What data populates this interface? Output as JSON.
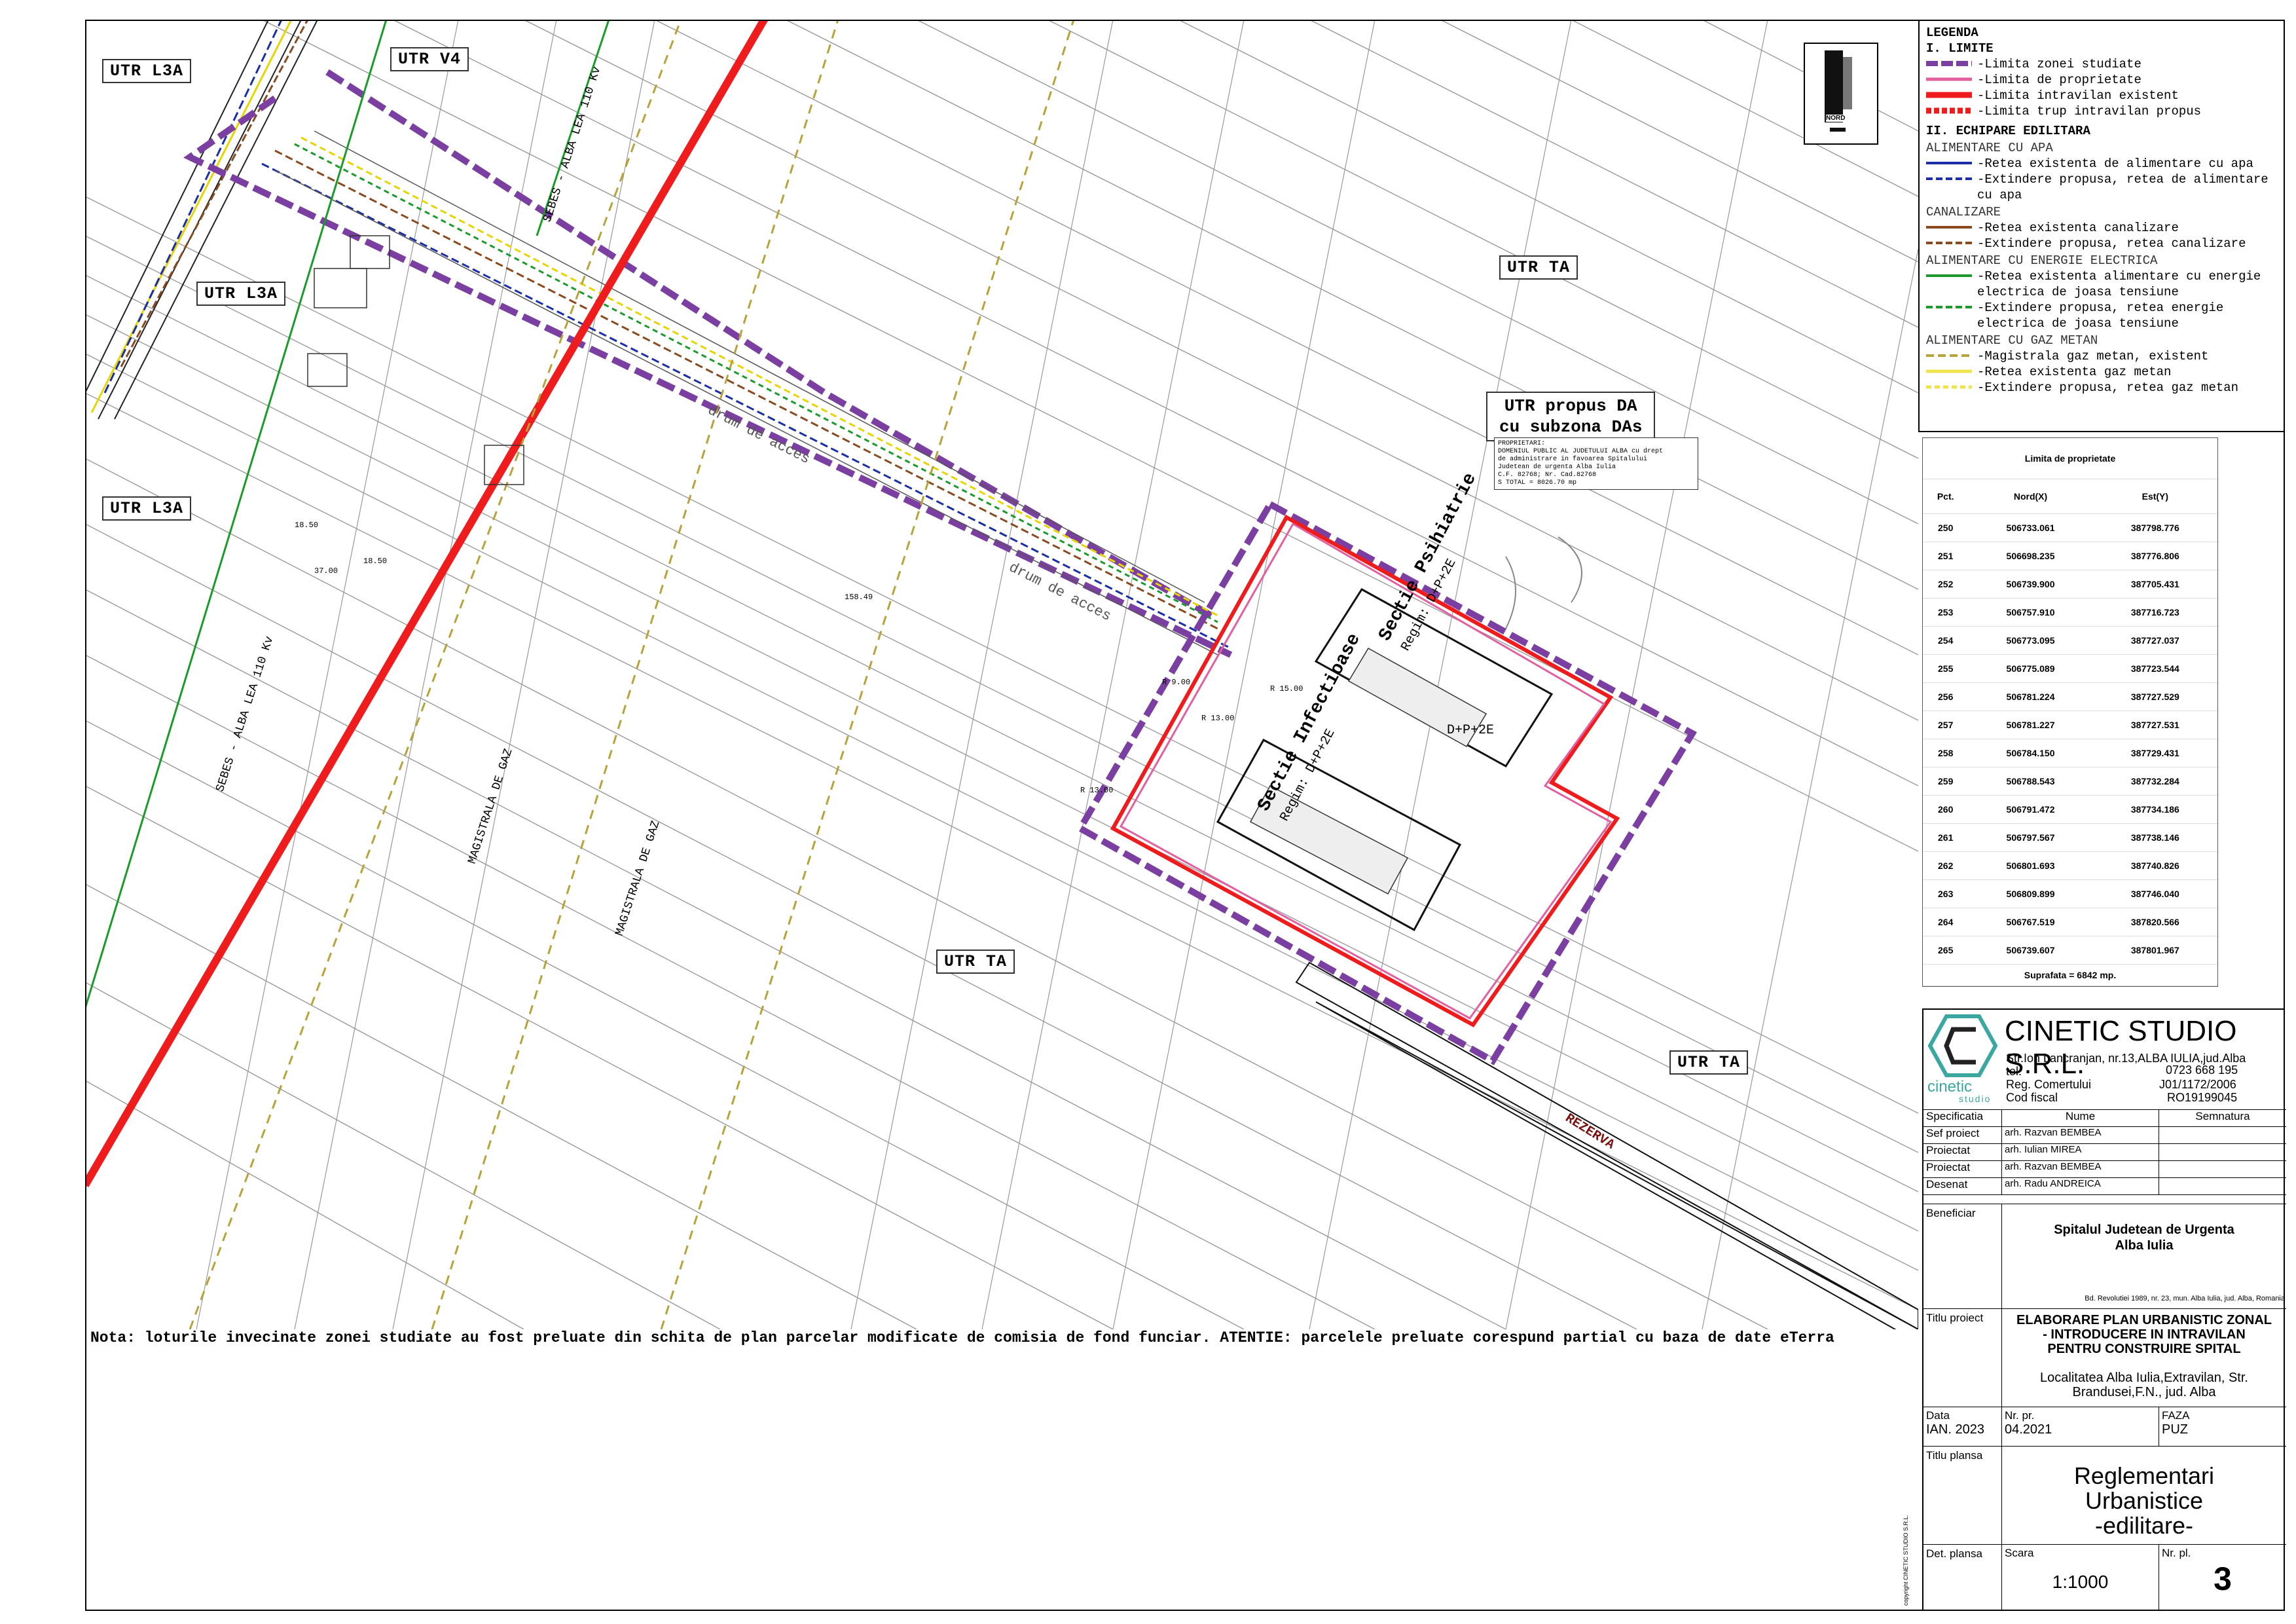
{
  "utr_labels": {
    "l3a_1": "UTR L3A",
    "v4": "UTR V4",
    "l3a_2": "UTR L3A",
    "l3a_3": "UTR L3A",
    "ta_1": "UTR TA",
    "ta_2": "UTR TA",
    "ta_3": "UTR TA",
    "proposed_line1": "UTR propus DA",
    "proposed_line2": "cu subzona DAs"
  },
  "owner_box": {
    "l1": "PROPRIETARI:",
    "l2": "DOMENIUL PUBLIC AL JUDETULUI ALBA cu drept",
    "l3": "de administrare in favoarea Spitalului",
    "l4": "Judetean de urgenta Alba Iulia",
    "l5": "C.F. 82768; Nr. Cad.82768",
    "l6": "S TOTAL = 8026.70 mp"
  },
  "map_text": {
    "north": "NORD",
    "road1": "drum de acces",
    "road2": "drum de acces",
    "bldg1_name": "Sectie Psihiatrie",
    "bldg1_regime": "Regim: D+P+2E",
    "bldg2_name": "Sectie Infectioase",
    "bldg2_regime": "Regim: D+P+2E",
    "bldg1_extra": "D+P+2E",
    "reserve": "REZERVA",
    "lea1": "SEBES - ALBA LEA 110 Kv",
    "lea2": "SEBES - ALBA LEA 110 Kv",
    "gas1": "MAGISTRALA DE GAZ",
    "gas2": "MAGISTRALA DE GAZ",
    "dim1": "18.50",
    "dim2": "37.00",
    "dim3": "18.50",
    "dim4": "158.49",
    "dim5": "R 13.00",
    "dim6": "R 9.00",
    "dim7": "R 13.00",
    "dim8": "R 15.00"
  },
  "note": "Nota: loturile invecinate zonei studiate au fost preluate din schita de plan parcelar modificate de comisia de fond funciar. ATENTIE: parcelele preluate corespund partial cu baza de date eTerra",
  "legend": {
    "title": "LEGENDA",
    "sec1": "I. LIMITE",
    "items1": [
      "-Limita zonei studiate",
      "-Limita de proprietate",
      "-Limita intravilan existent",
      "-Limita trup intravilan propus"
    ],
    "sec2": "II. ECHIPARE EDILITARA",
    "water": "ALIMENTARE CU APA",
    "water_items": [
      "-Retea existenta de alimentare cu apa",
      "-Extindere propusa, retea de alimentare cu apa"
    ],
    "sewer": "CANALIZARE",
    "sewer_items": [
      "-Retea existenta canalizare",
      "-Extindere propusa, retea canalizare"
    ],
    "power": "ALIMENTARE CU ENERGIE ELECTRICA",
    "power_items": [
      "-Retea existenta alimentare cu energie electrica de joasa tensiune",
      "-Extindere propusa, retea energie electrica de joasa tensiune"
    ],
    "gas": "ALIMENTARE CU GAZ METAN",
    "gas_items": [
      "-Magistrala gaz metan, existent",
      "-Retea existenta gaz metan",
      "-Extindere propusa, retea gaz metan"
    ],
    "colors": {
      "purple": "#7a3fa0",
      "pink": "#e060a0",
      "red": "#ee1c1c",
      "blue": "#1a2ea8",
      "brown": "#8a4a20",
      "green": "#1a9a2a",
      "gas": "#b8a23a",
      "yellow": "#f0e24a"
    }
  },
  "coords": {
    "title": "Limita de proprietate",
    "h_pct": "Pct.",
    "h_n": "Nord(X)",
    "h_e": "Est(Y)",
    "rows": [
      [
        "250",
        "506733.061",
        "387798.776"
      ],
      [
        "251",
        "506698.235",
        "387776.806"
      ],
      [
        "252",
        "506739.900",
        "387705.431"
      ],
      [
        "253",
        "506757.910",
        "387716.723"
      ],
      [
        "254",
        "506773.095",
        "387727.037"
      ],
      [
        "255",
        "506775.089",
        "387723.544"
      ],
      [
        "256",
        "506781.224",
        "387727.529"
      ],
      [
        "257",
        "506781.227",
        "387727.531"
      ],
      [
        "258",
        "506784.150",
        "387729.431"
      ],
      [
        "259",
        "506788.543",
        "387732.284"
      ],
      [
        "260",
        "506791.472",
        "387734.186"
      ],
      [
        "261",
        "506797.567",
        "387738.146"
      ],
      [
        "262",
        "506801.693",
        "387740.826"
      ],
      [
        "263",
        "506809.899",
        "387746.040"
      ],
      [
        "264",
        "506767.519",
        "387820.566"
      ],
      [
        "265",
        "506739.607",
        "387801.967"
      ]
    ],
    "area": "Suprafata = 6842 mp."
  },
  "title_block": {
    "company": "CINETIC STUDIO S.R.L.",
    "logo_word": "cinetic",
    "logo_sub": "studio",
    "address": "Str.Ion Lancranjan, nr.13,ALBA IULIA,jud.Alba",
    "tel_label": "tel:",
    "tel": "0723 668 195",
    "reg_label": "Reg. Comertului",
    "reg": "J01/1172/2006",
    "cf_label": "Cod fiscal",
    "cf": "RO19199045",
    "spec": "Specificatia",
    "name": "Nume",
    "sign": "Semnatura",
    "roles": [
      [
        "Sef proiect",
        "arh. Razvan BEMBEA"
      ],
      [
        "Proiectat",
        "arh. Iulian MIREA"
      ],
      [
        "Proiectat",
        "arh. Razvan BEMBEA"
      ],
      [
        "Desenat",
        "arh. Radu ANDREICA"
      ]
    ],
    "beneficiar_label": "Beneficiar",
    "beneficiar_1": "Spitalul Judetean de Urgenta",
    "beneficiar_2": "Alba Iulia",
    "beneficiar_addr": "Bd. Revolutiei 1989, nr. 23, mun. Alba Iulia, jud. Alba, Romania",
    "titlu_proiect_label": "Titlu proiect",
    "titlu_1": "ELABORARE PLAN URBANISTIC ZONAL",
    "titlu_2": "- INTRODUCERE IN INTRAVILAN",
    "titlu_3": "PENTRU CONSTRUIRE SPITAL",
    "loc_1": "Localitatea Alba Iulia,Extravilan, Str.",
    "loc_2": "Brandusei,F.N., jud. Alba",
    "data_label": "Data",
    "data": "IAN. 2023",
    "nrpr_label": "Nr. pr.",
    "nrpr": "04.2021",
    "faza_label": "FAZA",
    "faza": "PUZ",
    "titlu_plansa_label": "Titlu plansa",
    "plansa_1": "Reglementari",
    "plansa_2": "Urbanistice",
    "plansa_3": "-edilitare-",
    "det_label": "Det. plansa",
    "scara_label": "Scara",
    "scara": "1:1000",
    "nrpl_label": "Nr. pl.",
    "nrpl": "3",
    "copyright": "copyright CINETIC STUDIO S.R.L."
  }
}
